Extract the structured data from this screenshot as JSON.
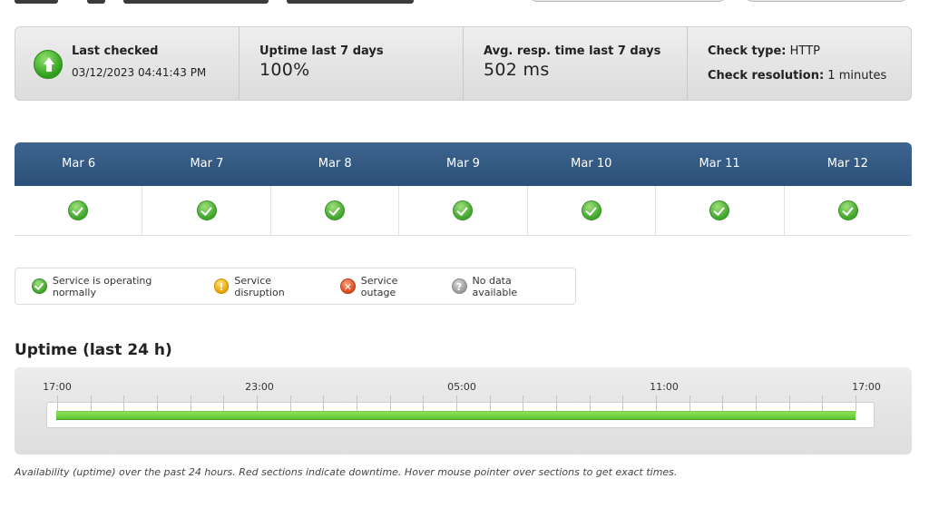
{
  "summary": {
    "last_checked_label": "Last checked",
    "last_checked_value": "03/12/2023 04:41:43 PM",
    "uptime_label": "Uptime last 7 days",
    "uptime_value": "100%",
    "resp_label": "Avg. resp. time last 7 days",
    "resp_value": "502 ms",
    "check_type_label": "Check type:",
    "check_type_value": "HTTP",
    "check_res_label": "Check resolution:",
    "check_res_value": "1 minutes"
  },
  "days": [
    {
      "label": "Mar 6",
      "status": "ok"
    },
    {
      "label": "Mar 7",
      "status": "ok"
    },
    {
      "label": "Mar 8",
      "status": "ok"
    },
    {
      "label": "Mar 9",
      "status": "ok"
    },
    {
      "label": "Mar 10",
      "status": "ok"
    },
    {
      "label": "Mar 11",
      "status": "ok"
    },
    {
      "label": "Mar 12",
      "status": "ok"
    }
  ],
  "legend": {
    "ok": "Service is operating normally",
    "disruption": "Service disruption",
    "outage": "Service outage",
    "no_data": "No data available"
  },
  "uptime24": {
    "title": "Uptime (last 24 h)",
    "tick_labels": [
      "17:00",
      "23:00",
      "05:00",
      "11:00",
      "17:00"
    ],
    "uptime_fraction": 1.0,
    "footnote": "Availability (uptime) over the past 24 hours. Red sections indicate downtime. Hover mouse pointer over sections to get exact times."
  },
  "colors": {
    "header_blue": "#2b4f78",
    "ok_green": "#3ea52a",
    "bar_green": "#6fd242"
  }
}
